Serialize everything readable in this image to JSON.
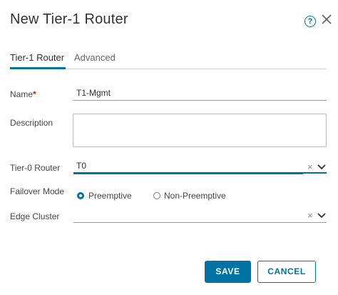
{
  "dialog": {
    "title": "New Tier-1 Router"
  },
  "tabs": [
    {
      "label": "Tier-1 Router",
      "active": true
    },
    {
      "label": "Advanced",
      "active": false
    }
  ],
  "form": {
    "name": {
      "label": "Name",
      "required_mark": "*",
      "value": "T1-Mgmt"
    },
    "description": {
      "label": "Description",
      "value": ""
    },
    "tier0_router": {
      "label": "Tier-0 Router",
      "value": "T0"
    },
    "failover_mode": {
      "label": "Failover Mode",
      "options": [
        {
          "label": "Preemptive",
          "selected": true
        },
        {
          "label": "Non-Preemptive",
          "selected": false
        }
      ]
    },
    "edge_cluster": {
      "label": "Edge Cluster",
      "value": ""
    }
  },
  "buttons": {
    "save": "SAVE",
    "cancel": "CANCEL"
  },
  "icons": {
    "help": "help-icon",
    "close": "close-icon",
    "clear": "clear-icon",
    "dropdown": "chevron-down-icon"
  },
  "colors": {
    "accent": "#0072a3",
    "required": "#c92100",
    "text": "#313131"
  }
}
